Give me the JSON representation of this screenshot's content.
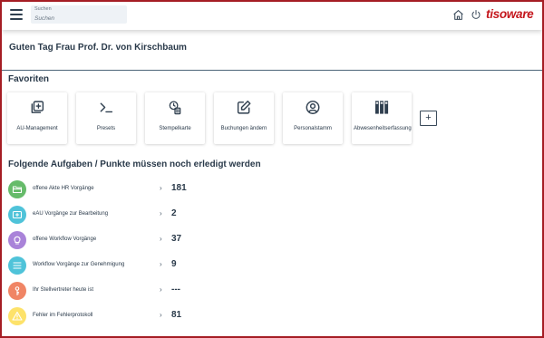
{
  "header": {
    "search_label": "Suchen",
    "search_placeholder": "Suchen",
    "logo_text": "tisoware",
    "home_icon": "home-icon",
    "power_icon": "power-icon",
    "menu_icon": "hamburger-menu-icon"
  },
  "greeting": "Guten Tag Frau Prof. Dr. von Kirschbaum",
  "favorites": {
    "title": "Favoriten",
    "tiles": [
      {
        "label": "AU-Management",
        "icon": "copy-plus-icon"
      },
      {
        "label": "Presets",
        "icon": "terminal-prompt-icon"
      },
      {
        "label": "Stempelkarte",
        "icon": "clock-document-icon"
      },
      {
        "label": "Buchungen ändern",
        "icon": "edit-pencil-icon"
      },
      {
        "label": "Personalstamm",
        "icon": "user-circle-icon"
      },
      {
        "label": "Abwesenheitserfassung",
        "icon": "binders-icon"
      }
    ],
    "add_label": "+"
  },
  "tasks": {
    "title": "Folgende Aufgaben / Punkte müssen noch erledigt werden",
    "items": [
      {
        "label": "offene Akte HR Vorgänge",
        "count": "181",
        "color": "#66bb6a",
        "icon": "folder-icon"
      },
      {
        "label": "eAU Vorgänge zur Bearbeitung",
        "count": "2",
        "color": "#4fc3d9",
        "icon": "medical-card-icon"
      },
      {
        "label": "offene Workflow Vorgänge",
        "count": "37",
        "color": "#a983d9",
        "icon": "lightbulb-icon"
      },
      {
        "label": "Workflow Vorgänge zur Genehmigung",
        "count": "9",
        "color": "#4fc3d9",
        "icon": "list-icon"
      },
      {
        "label": "Ihr Stellvertreter heute ist",
        "count": "---",
        "color": "#f08565",
        "icon": "person-key-icon"
      },
      {
        "label": "Fehler im Fehlerprotokoll",
        "count": "81",
        "color": "#fde26a",
        "icon": "warning-icon"
      }
    ],
    "chevron": "›"
  },
  "colors": {
    "brand": "#c4161c",
    "frame": "#a51d24",
    "text": "#2a3a4a",
    "divider": "#4c6478"
  }
}
